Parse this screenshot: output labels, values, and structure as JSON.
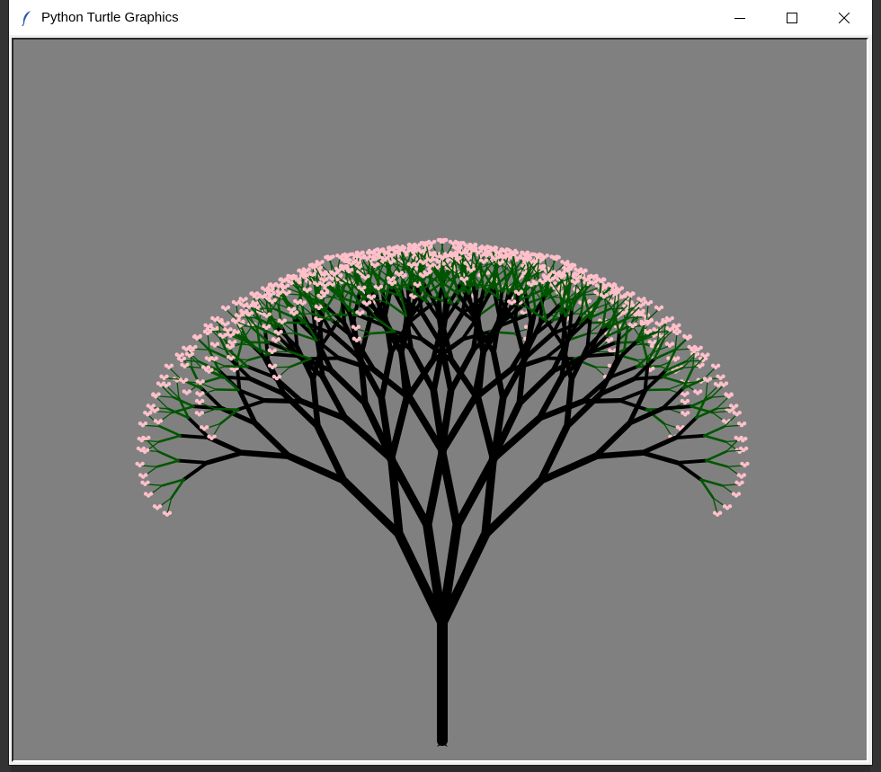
{
  "window": {
    "title": "Python Turtle Graphics",
    "icon": "feather-icon",
    "controls": {
      "minimize": "minimize-icon",
      "maximize": "maximize-icon",
      "close": "close-icon"
    }
  },
  "canvas": {
    "background_color": "#808080",
    "tree": {
      "trunk_color": "#000000",
      "leaf_branch_color": "#005500",
      "blossom_color": "#ffc0cb",
      "recursion_depth": 8,
      "branch_angle_deg": 20,
      "shrink_ratio": 0.78
    }
  }
}
